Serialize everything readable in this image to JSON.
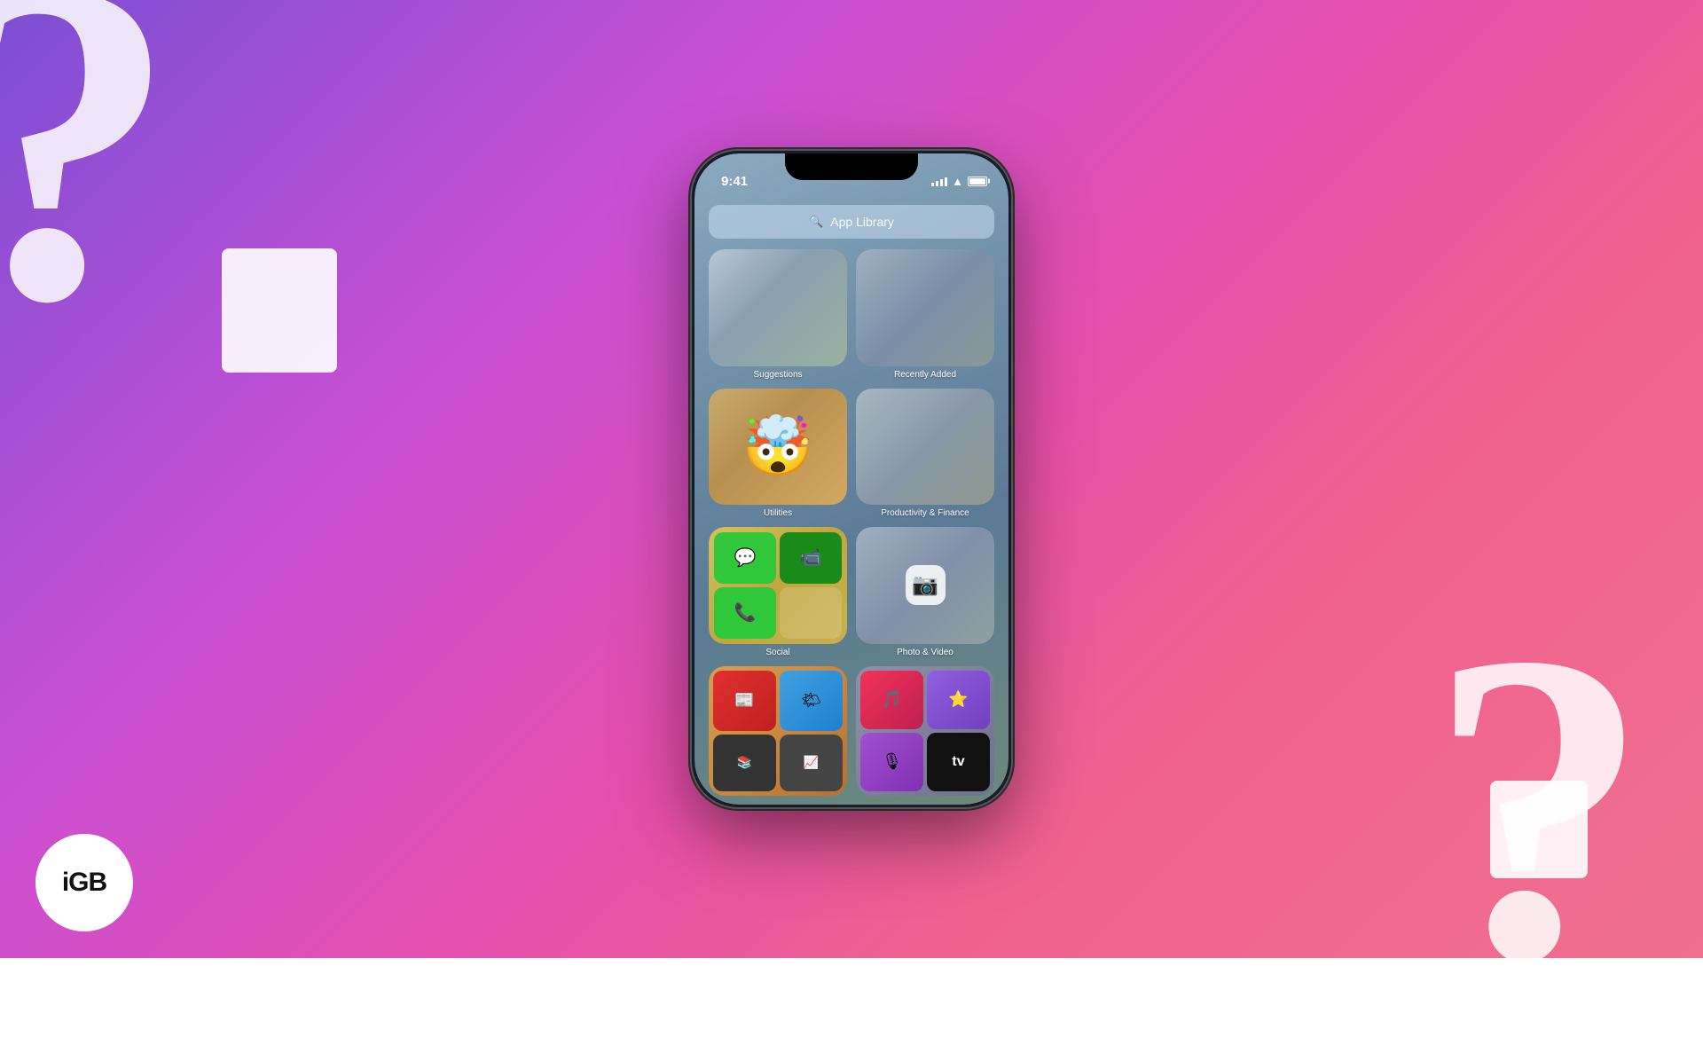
{
  "background": {
    "gradient_start": "#7B4FD4",
    "gradient_end": "#F07090"
  },
  "logo": {
    "text": "iGB"
  },
  "phone": {
    "status_bar": {
      "time": "9:41",
      "signal_bars": [
        4,
        5,
        6,
        8,
        10
      ],
      "wifi": "WiFi",
      "battery": "full"
    },
    "search": {
      "placeholder": "App Library",
      "icon": "🔍"
    },
    "grid": {
      "cells": [
        {
          "id": "suggestions",
          "label": "Suggestions"
        },
        {
          "id": "recently-added",
          "label": "Recently Added"
        },
        {
          "id": "utilities",
          "label": "Utilities",
          "emoji": "🤯"
        },
        {
          "id": "productivity",
          "label": "Productivity & Finance"
        },
        {
          "id": "social",
          "label": "Social"
        },
        {
          "id": "photo-video",
          "label": "Photo & Video"
        }
      ]
    }
  }
}
